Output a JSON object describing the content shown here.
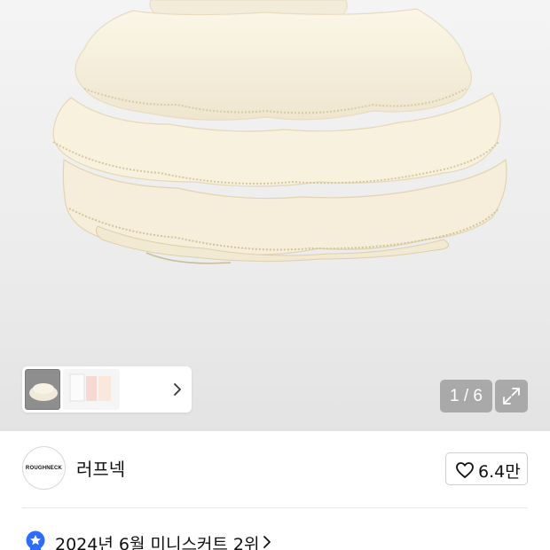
{
  "gallery": {
    "image_subject": "cream ruffled tiered mini skirt",
    "pager_text": "1 / 6",
    "current_index": 1,
    "total_images": 6,
    "thumbnails": [
      "skirt-photo-thumbnail",
      "size-chart-thumbnail"
    ],
    "expand_icon": "expand-arrows-icon",
    "thumb_chevron_icon": "chevron-right-icon"
  },
  "brand": {
    "logo_text": "ROUGHNECK",
    "name": "러프넥",
    "like_icon": "heart-outline-icon",
    "like_count": "6.4만"
  },
  "ranking": {
    "badge_icon": "star-badge-icon",
    "badge_color": "#2f6bff",
    "text": "2024년 6월 미니스커트 2위",
    "chevron_icon": "chevron-right-icon"
  }
}
